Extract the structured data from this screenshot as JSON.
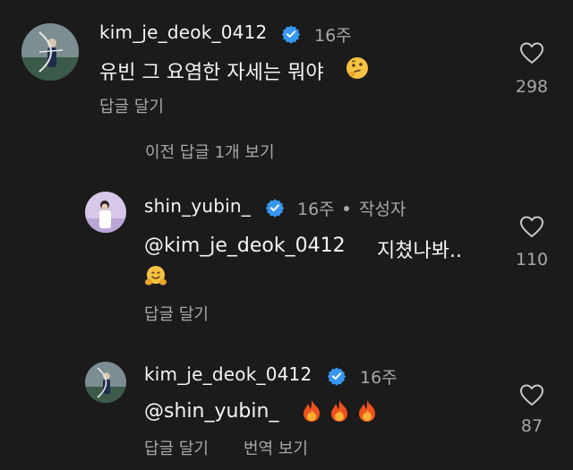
{
  "comments": [
    {
      "username": "kim_je_deok_0412",
      "time": "16주",
      "text": "유빈 그 요염한 자세는 뭐야",
      "emoji": "thinking-face",
      "reply_label": "답글 달기",
      "likes": "298"
    },
    {
      "username": "shin_yubin_",
      "time": "16주",
      "author_badge": "작성자",
      "mention": "@kim_je_deok_0412",
      "text": "지쳤나봐..",
      "emoji": "hugging-face",
      "reply_label": "답글 달기",
      "likes": "110"
    },
    {
      "username": "kim_je_deok_0412",
      "time": "16주",
      "mention": "@shin_yubin_",
      "emoji": "fire x3",
      "reply_label": "답글 달기",
      "translate_label": "번역 보기",
      "likes": "87"
    }
  ],
  "view_previous_replies": "이전 답글 1개 보기",
  "colors": {
    "background": "#1b1b1b",
    "primary_text": "#f5f5f5",
    "secondary_text": "#a8a8a8",
    "verified_blue": "#3797f0"
  }
}
